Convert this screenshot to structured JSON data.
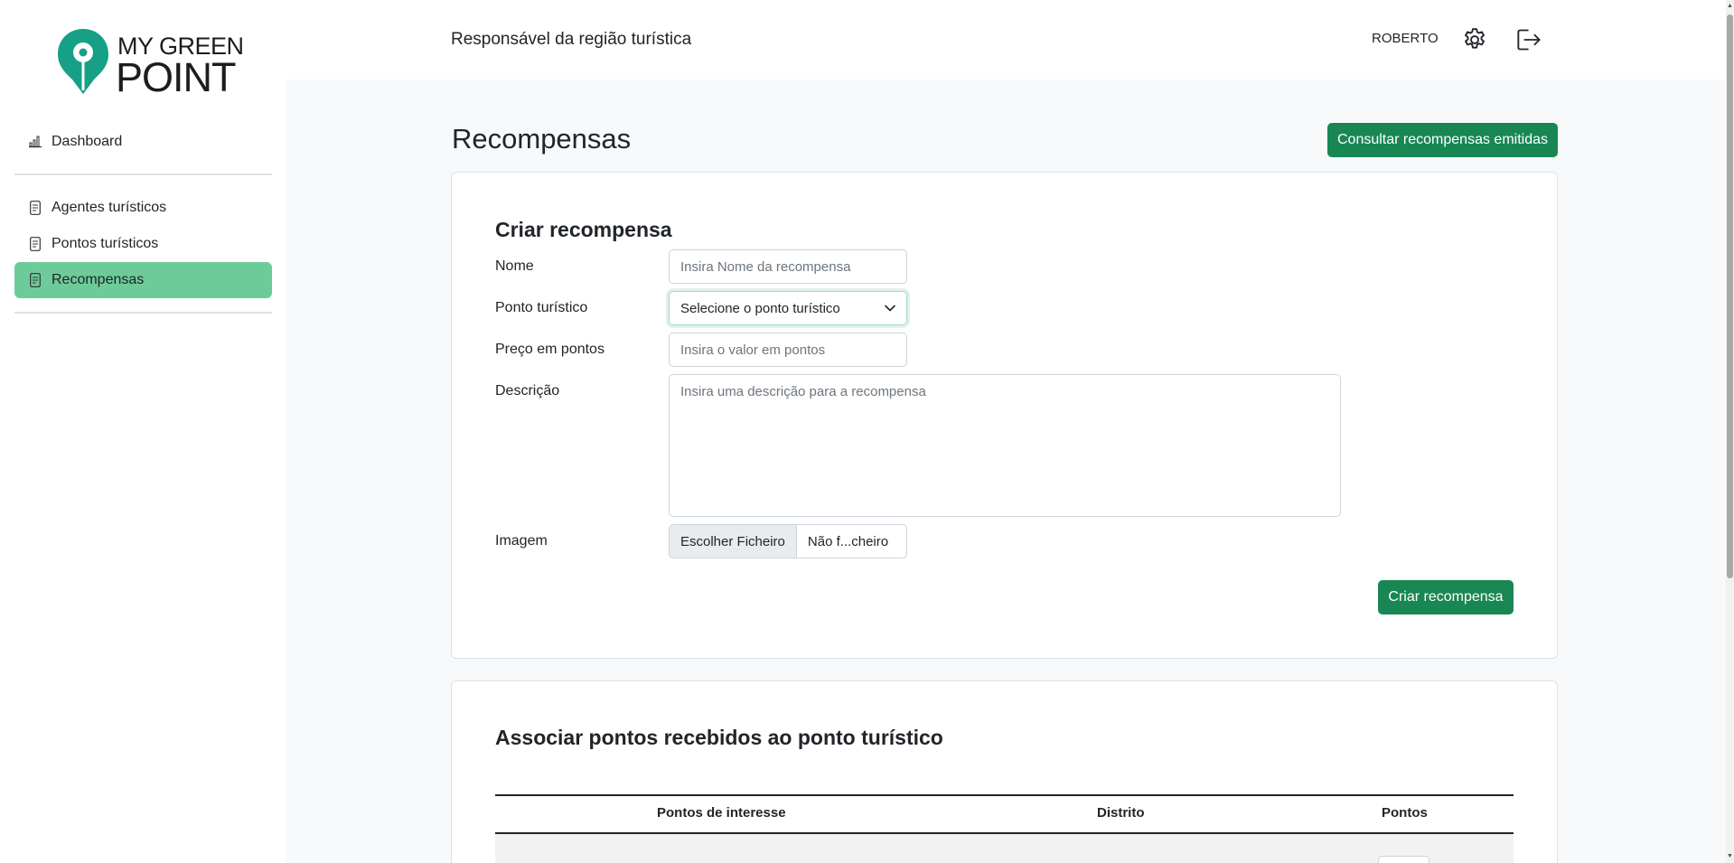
{
  "brand": {
    "line1": "MY GREEN",
    "line2": "POINT",
    "pin_color": "#16a085"
  },
  "sidebar": {
    "items": [
      {
        "label": "Dashboard",
        "icon": "bar-chart-icon",
        "active": false
      },
      {
        "label": "Agentes turísticos",
        "icon": "document-icon",
        "active": false
      },
      {
        "label": "Pontos turísticos",
        "icon": "document-icon",
        "active": false
      },
      {
        "label": "Recompensas",
        "icon": "document-icon",
        "active": true
      }
    ],
    "active_color": "#6dcb9a"
  },
  "header": {
    "title": "Responsável da região turística",
    "user_name": "ROBERTO",
    "icons": [
      "gear-icon",
      "logout-icon"
    ]
  },
  "main": {
    "title": "Recompensas",
    "top_button": "Consultar recompensas emitidas",
    "accent_color": "#198754"
  },
  "create_form": {
    "title": "Criar recompensa",
    "fields": {
      "name": {
        "label": "Nome",
        "placeholder": "Insira Nome da recompensa"
      },
      "tourist_point": {
        "label": "Ponto turístico",
        "selected": "Selecione o ponto turístico"
      },
      "price": {
        "label": "Preço em pontos",
        "placeholder": "Insira o valor em pontos"
      },
      "description": {
        "label": "Descrição",
        "placeholder": "Insira uma descrição para a recompensa"
      },
      "image": {
        "label": "Imagem",
        "button": "Escolher Ficheiro",
        "file_name": "Não f...cheiro"
      }
    },
    "submit": "Criar recompensa"
  },
  "associate": {
    "title": "Associar pontos recebidos ao ponto turístico",
    "columns": [
      "Pontos de interesse",
      "Distrito",
      "Pontos"
    ]
  }
}
